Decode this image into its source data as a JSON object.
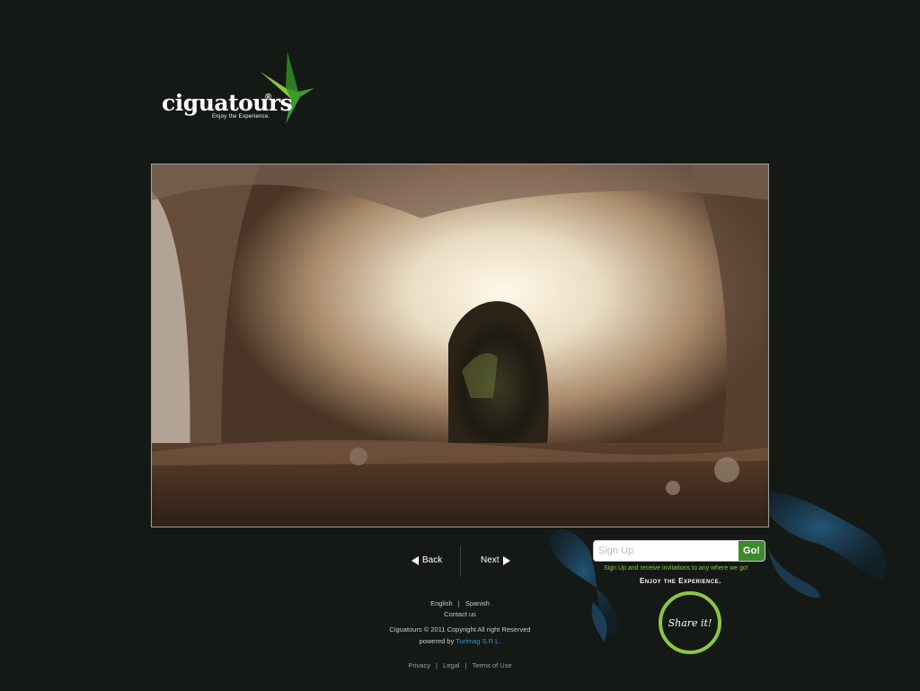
{
  "logo": {
    "wordmark": "ciguatours",
    "registered": "®",
    "tagline": "Enjoy the Experience.",
    "brand_green": "#3a9b2a",
    "brand_light_green": "#8cc63f"
  },
  "photo": {
    "subject_icon": "cave-photo"
  },
  "nav": {
    "back_label": "Back",
    "next_label": "Next"
  },
  "footer": {
    "lang_english": "English",
    "lang_separator": "|",
    "lang_spanish": "Spanish",
    "contact": "Contact us",
    "copyright": "Ciguatours © 2011 Copyright All right Reserved",
    "powered_prefix": "powered by",
    "powered_link": "Turimag S.R.L.",
    "privacy": "Privacy",
    "legal": "Legal",
    "terms": "Terms of Use",
    "legal_separator": "|"
  },
  "signup": {
    "placeholder": "Sign Up",
    "value": "",
    "go_label": "Go!",
    "hint": "Sign Up and receive invitations to any where we go!",
    "enjoy": "Enjoy the Experience."
  },
  "share": {
    "label": "Share it!"
  },
  "colors": {
    "background": "#141916",
    "accent_green": "#8cc63f",
    "link_blue": "#3f8fcf",
    "splash_blue": "#1f4e74"
  }
}
